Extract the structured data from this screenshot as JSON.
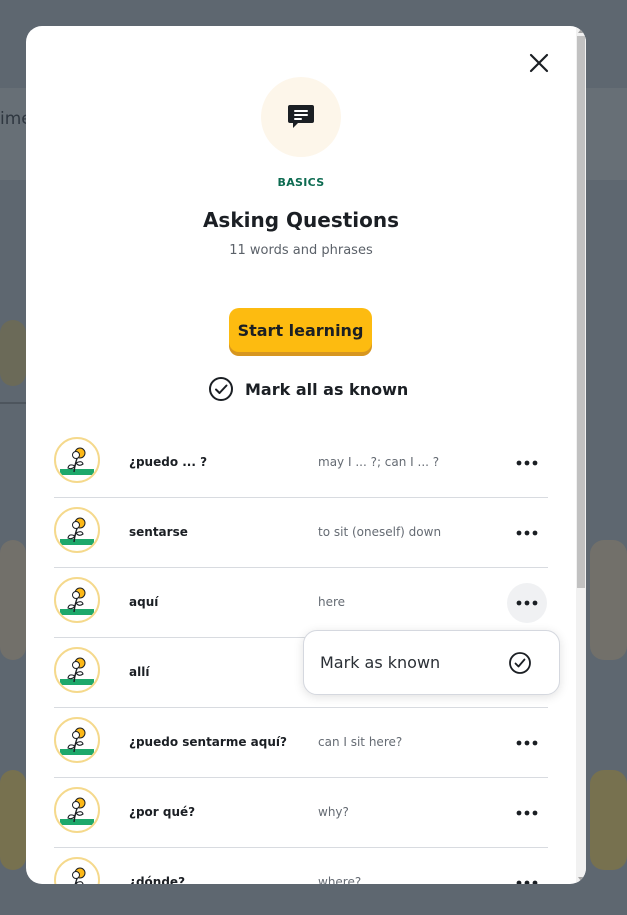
{
  "background": {
    "partial_text": "ime"
  },
  "modal": {
    "category": "BASICS",
    "title": "Asking Questions",
    "subtitle": "11 words and phrases",
    "start_button": "Start learning",
    "mark_all": "Mark all as known"
  },
  "words": [
    {
      "term": "¿puedo ... ?",
      "gloss": "may I ... ?; can I ... ?"
    },
    {
      "term": "sentarse",
      "gloss": "to sit (oneself) down"
    },
    {
      "term": "aquí",
      "gloss": "here"
    },
    {
      "term": "allí",
      "gloss": ""
    },
    {
      "term": "¿puedo sentarme aquí?",
      "gloss": "can I sit here?"
    },
    {
      "term": "¿por qué?",
      "gloss": "why?"
    },
    {
      "term": "¿dónde?",
      "gloss": "where?"
    }
  ],
  "popup": {
    "label": "Mark as known"
  },
  "colors": {
    "accent_button": "#fdbb10",
    "category_green": "#0d6b51",
    "avatar_ring": "#f5d98c"
  },
  "icons": {
    "close": "close-icon",
    "topic": "chat-bubble-icon",
    "check": "check-circle-icon",
    "more": "more-dots-icon",
    "word": "flower-icon"
  }
}
